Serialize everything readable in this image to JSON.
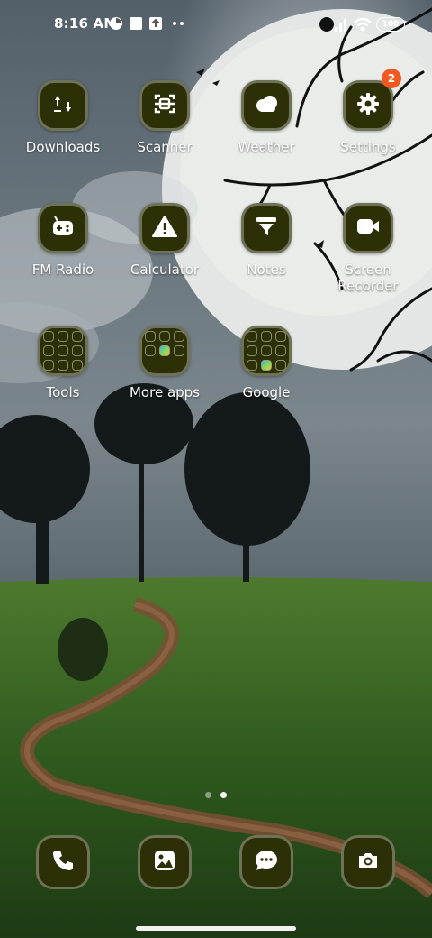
{
  "status_bar": {
    "time": "8:16 AM",
    "battery": "100",
    "icons": [
      "gauge-icon",
      "notification-square-icon",
      "upload-box-icon",
      "more-dots-icon",
      "dnd-icon",
      "signal-icon",
      "wifi-icon",
      "battery-icon"
    ]
  },
  "apps": [
    {
      "label": "Downloads",
      "icon": "downloads-icon"
    },
    {
      "label": "Scanner",
      "icon": "scanner-icon"
    },
    {
      "label": "Weather",
      "icon": "weather-cloud-icon"
    },
    {
      "label": "Settings",
      "icon": "gear-icon",
      "badge": "2"
    },
    {
      "label": "FM Radio",
      "icon": "radio-icon"
    },
    {
      "label": "Calculator",
      "icon": "calculator-warning-icon"
    },
    {
      "label": "Notes",
      "icon": "notes-funnel-icon"
    },
    {
      "label": "Screen Recorder",
      "icon": "video-camera-icon"
    }
  ],
  "folders": [
    {
      "label": "Tools"
    },
    {
      "label": "More apps"
    },
    {
      "label": "Google"
    }
  ],
  "page_indicator": {
    "pages": 2,
    "current": 2
  },
  "dock": [
    {
      "icon": "phone-icon"
    },
    {
      "icon": "gallery-icon"
    },
    {
      "icon": "messages-icon"
    },
    {
      "icon": "camera-icon"
    }
  ],
  "colors": {
    "tile": "#2d3007",
    "tile_border": "#6e7257",
    "badge": "#f25a1f"
  }
}
